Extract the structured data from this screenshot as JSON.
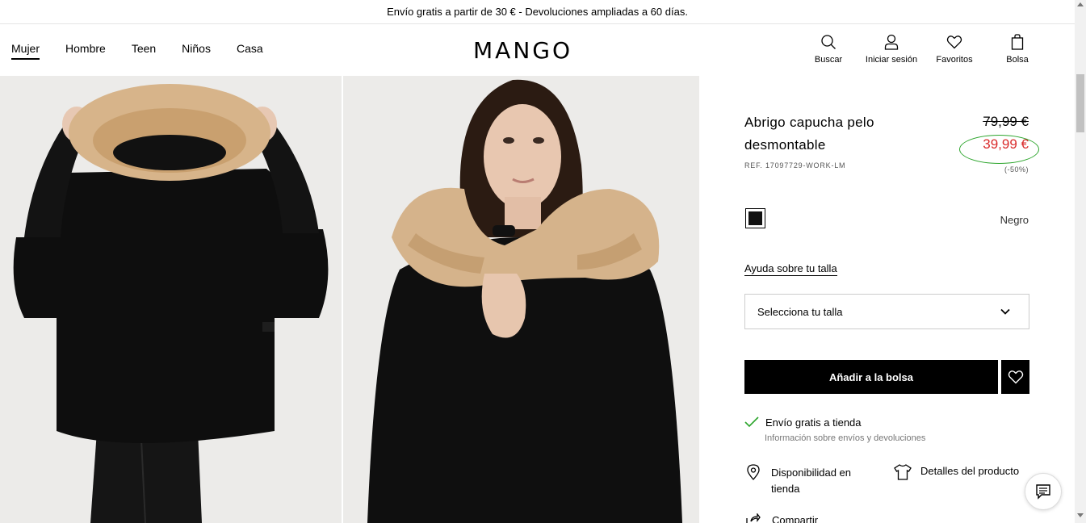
{
  "promo": {
    "text": "Envío gratis a partir de 30 € - Devoluciones ampliadas a 60 días."
  },
  "nav": {
    "items": [
      "Mujer",
      "Hombre",
      "Teen",
      "Niños",
      "Casa"
    ],
    "active": "Mujer"
  },
  "logo": "MANGO",
  "header_actions": {
    "search": "Buscar",
    "login": "Iniciar sesión",
    "favorites": "Favoritos",
    "bag": "Bolsa"
  },
  "product": {
    "title": "Abrigo capucha pelo desmontable",
    "ref": "REF. 17097729-WORK-LM",
    "old_price": "79,99 €",
    "new_price": "39,99 €",
    "discount": "(-50%)",
    "color_name": "Negro",
    "size_help": "Ayuda sobre tu talla",
    "size_placeholder": "Selecciona tu talla",
    "add_to_bag": "Añadir a la bolsa",
    "shipping": "Envío gratis a tienda",
    "shipping_info": "Información sobre envíos y devoluciones",
    "availability": "Disponibilidad en tienda",
    "details": "Detalles del producto",
    "share": "Compartir"
  },
  "colors": {
    "sale": "#d92b2b",
    "highlight_circle": "#2ca52c",
    "check": "#2ca52c"
  }
}
